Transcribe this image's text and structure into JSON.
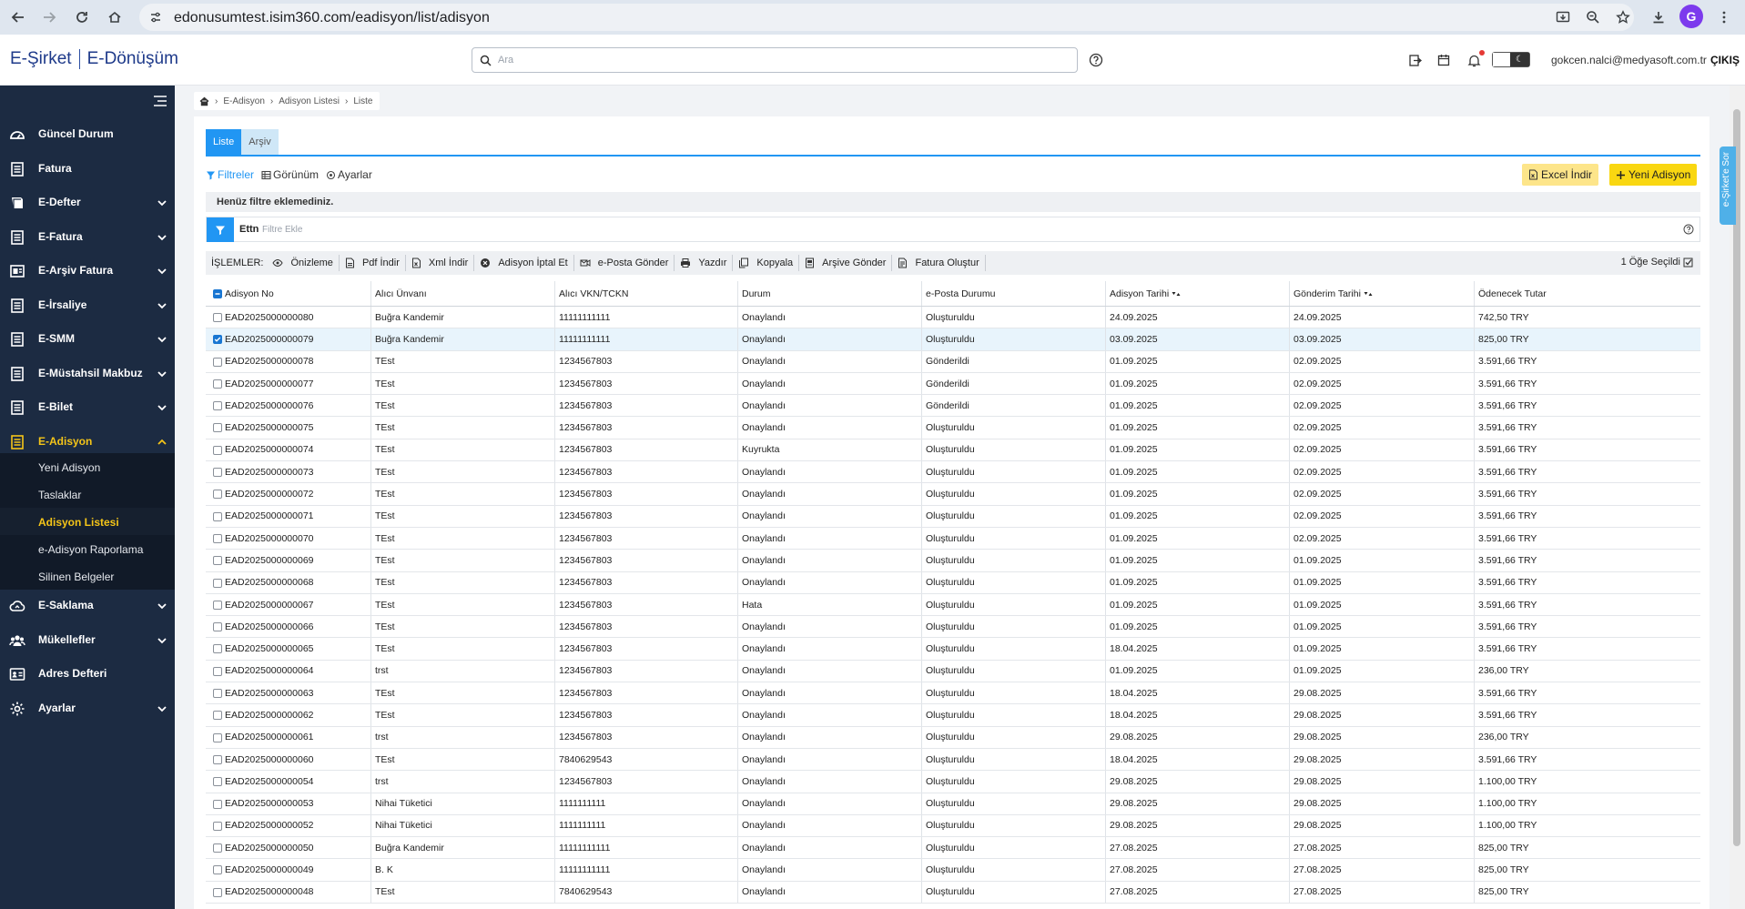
{
  "browser": {
    "url": "edonusumtest.isim360.com/eadisyon/list/adisyon",
    "profile_initial": "G"
  },
  "header": {
    "brand_left": "E-Şirket",
    "brand_right": "E-Dönüşüm",
    "search_placeholder": "Ara",
    "user_email": "gokcen.nalci@medyasoft.com.tr",
    "logout_label": "ÇIKIŞ",
    "notification_dot_color": "#e53935"
  },
  "sidebar": {
    "items": [
      {
        "label": "Güncel Durum",
        "icon": "dashboard-icon",
        "has_chevron": false
      },
      {
        "label": "Fatura",
        "icon": "document-icon",
        "has_chevron": false
      },
      {
        "label": "E-Defter",
        "icon": "book-icon",
        "has_chevron": true
      },
      {
        "label": "E-Fatura",
        "icon": "document-icon",
        "has_chevron": true
      },
      {
        "label": "E-Arşiv Fatura",
        "icon": "archive-document-icon",
        "has_chevron": true
      },
      {
        "label": "E-İrsaliye",
        "icon": "document-icon",
        "has_chevron": true
      },
      {
        "label": "E-SMM",
        "icon": "document-icon",
        "has_chevron": true
      },
      {
        "label": "E-Müstahsil Makbuz",
        "icon": "document-icon",
        "has_chevron": true
      },
      {
        "label": "E-Bilet",
        "icon": "document-icon",
        "has_chevron": true
      },
      {
        "label": "E-Adisyon",
        "icon": "document-icon",
        "has_chevron": true,
        "active": true
      },
      {
        "label": "E-Saklama",
        "icon": "cloud-icon",
        "has_chevron": true
      },
      {
        "label": "Mükellefler",
        "icon": "users-icon",
        "has_chevron": true
      },
      {
        "label": "Adres Defteri",
        "icon": "address-card-icon",
        "has_chevron": false
      },
      {
        "label": "Ayarlar",
        "icon": "gear-icon",
        "has_chevron": true
      }
    ],
    "subitems": [
      {
        "label": "Yeni Adisyon"
      },
      {
        "label": "Taslaklar"
      },
      {
        "label": "Adisyon Listesi",
        "active": true
      },
      {
        "label": "e-Adisyon Raporlama"
      },
      {
        "label": "Silinen Belgeler"
      }
    ],
    "accent_color": "#f5c518"
  },
  "breadcrumb": [
    "E-Adisyon",
    "Adisyon Listesi",
    "Liste"
  ],
  "tabs": [
    {
      "label": "Liste",
      "active": true
    },
    {
      "label": "Arşiv",
      "active": false
    }
  ],
  "toolbar": {
    "filters_label": "Filtreler",
    "view_label": "Görünüm",
    "settings_label": "Ayarlar",
    "excel_label": "Excel İndir",
    "new_label": "Yeni Adisyon"
  },
  "filter": {
    "no_filter_text": "Henüz filtre eklemediniz.",
    "field_label": "Ettn",
    "input_placeholder": "Filtre Ekle"
  },
  "operations": {
    "title": "İŞLEMLER:",
    "items": [
      {
        "label": "Önizleme",
        "icon": "eye-icon"
      },
      {
        "label": "Pdf İndir",
        "icon": "pdf-icon"
      },
      {
        "label": "Xml İndir",
        "icon": "xml-icon"
      },
      {
        "label": "Adisyon İptal Et",
        "icon": "cancel-icon"
      },
      {
        "label": "e-Posta Gönder",
        "icon": "send-mail-icon"
      },
      {
        "label": "Yazdır",
        "icon": "print-icon"
      },
      {
        "label": "Kopyala",
        "icon": "copy-icon"
      },
      {
        "label": "Arşive Gönder",
        "icon": "archive-icon"
      },
      {
        "label": "Fatura Oluştur",
        "icon": "invoice-icon"
      }
    ],
    "selected_text": "1 Öğe Seçildi"
  },
  "table": {
    "columns": [
      "Adisyon No",
      "Alıcı Ünvanı",
      "Alıcı VKN/TCKN",
      "Durum",
      "e-Posta Durumu",
      "Adisyon Tarihi",
      "Gönderim Tarihi",
      "Ödenecek Tutar"
    ],
    "rows": [
      [
        "EAD2025000000080",
        "Buğra Kandemir",
        "11111111111",
        "Onaylandı",
        "Oluşturuldu",
        "24.09.2025",
        "24.09.2025",
        "742,50 TRY"
      ],
      [
        "EAD2025000000079",
        "Buğra Kandemir",
        "11111111111",
        "Onaylandı",
        "Oluşturuldu",
        "03.09.2025",
        "03.09.2025",
        "825,00 TRY"
      ],
      [
        "EAD2025000000078",
        "TEst",
        "1234567803",
        "Onaylandı",
        "Gönderildi",
        "01.09.2025",
        "02.09.2025",
        "3.591,66 TRY"
      ],
      [
        "EAD2025000000077",
        "TEst",
        "1234567803",
        "Onaylandı",
        "Gönderildi",
        "01.09.2025",
        "02.09.2025",
        "3.591,66 TRY"
      ],
      [
        "EAD2025000000076",
        "TEst",
        "1234567803",
        "Onaylandı",
        "Gönderildi",
        "01.09.2025",
        "02.09.2025",
        "3.591,66 TRY"
      ],
      [
        "EAD2025000000075",
        "TEst",
        "1234567803",
        "Onaylandı",
        "Oluşturuldu",
        "01.09.2025",
        "02.09.2025",
        "3.591,66 TRY"
      ],
      [
        "EAD2025000000074",
        "TEst",
        "1234567803",
        "Kuyrukta",
        "Oluşturuldu",
        "01.09.2025",
        "02.09.2025",
        "3.591,66 TRY"
      ],
      [
        "EAD2025000000073",
        "TEst",
        "1234567803",
        "Onaylandı",
        "Oluşturuldu",
        "01.09.2025",
        "02.09.2025",
        "3.591,66 TRY"
      ],
      [
        "EAD2025000000072",
        "TEst",
        "1234567803",
        "Onaylandı",
        "Oluşturuldu",
        "01.09.2025",
        "02.09.2025",
        "3.591,66 TRY"
      ],
      [
        "EAD2025000000071",
        "TEst",
        "1234567803",
        "Onaylandı",
        "Oluşturuldu",
        "01.09.2025",
        "02.09.2025",
        "3.591,66 TRY"
      ],
      [
        "EAD2025000000070",
        "TEst",
        "1234567803",
        "Onaylandı",
        "Oluşturuldu",
        "01.09.2025",
        "02.09.2025",
        "3.591,66 TRY"
      ],
      [
        "EAD2025000000069",
        "TEst",
        "1234567803",
        "Onaylandı",
        "Oluşturuldu",
        "01.09.2025",
        "01.09.2025",
        "3.591,66 TRY"
      ],
      [
        "EAD2025000000068",
        "TEst",
        "1234567803",
        "Onaylandı",
        "Oluşturuldu",
        "01.09.2025",
        "01.09.2025",
        "3.591,66 TRY"
      ],
      [
        "EAD2025000000067",
        "TEst",
        "1234567803",
        "Hata",
        "Oluşturuldu",
        "01.09.2025",
        "01.09.2025",
        "3.591,66 TRY"
      ],
      [
        "EAD2025000000066",
        "TEst",
        "1234567803",
        "Onaylandı",
        "Oluşturuldu",
        "01.09.2025",
        "01.09.2025",
        "3.591,66 TRY"
      ],
      [
        "EAD2025000000065",
        "TEst",
        "1234567803",
        "Onaylandı",
        "Oluşturuldu",
        "18.04.2025",
        "01.09.2025",
        "3.591,66 TRY"
      ],
      [
        "EAD2025000000064",
        "trst",
        "1234567803",
        "Onaylandı",
        "Oluşturuldu",
        "01.09.2025",
        "01.09.2025",
        "236,00 TRY"
      ],
      [
        "EAD2025000000063",
        "TEst",
        "1234567803",
        "Onaylandı",
        "Oluşturuldu",
        "18.04.2025",
        "29.08.2025",
        "3.591,66 TRY"
      ],
      [
        "EAD2025000000062",
        "TEst",
        "1234567803",
        "Onaylandı",
        "Oluşturuldu",
        "18.04.2025",
        "29.08.2025",
        "3.591,66 TRY"
      ],
      [
        "EAD2025000000061",
        "trst",
        "1234567803",
        "Onaylandı",
        "Oluşturuldu",
        "29.08.2025",
        "29.08.2025",
        "236,00 TRY"
      ],
      [
        "EAD2025000000060",
        "TEst",
        "7840629543",
        "Onaylandı",
        "Oluşturuldu",
        "18.04.2025",
        "29.08.2025",
        "3.591,66 TRY"
      ],
      [
        "EAD2025000000054",
        "trst",
        "1234567803",
        "Onaylandı",
        "Oluşturuldu",
        "29.08.2025",
        "29.08.2025",
        "1.100,00 TRY"
      ],
      [
        "EAD2025000000053",
        "Nihai Tüketici",
        "1111111111",
        "Onaylandı",
        "Oluşturuldu",
        "29.08.2025",
        "29.08.2025",
        "1.100,00 TRY"
      ],
      [
        "EAD2025000000052",
        "Nihai Tüketici",
        "1111111111",
        "Onaylandı",
        "Oluşturuldu",
        "29.08.2025",
        "29.08.2025",
        "1.100,00 TRY"
      ],
      [
        "EAD2025000000050",
        "Buğra Kandemir",
        "11111111111",
        "Onaylandı",
        "Oluşturuldu",
        "27.08.2025",
        "27.08.2025",
        "825,00 TRY"
      ],
      [
        "EAD2025000000049",
        "B. K",
        "11111111111",
        "Onaylandı",
        "Oluşturuldu",
        "27.08.2025",
        "27.08.2025",
        "825,00 TRY"
      ],
      [
        "EAD2025000000048",
        "TEst",
        "7840629543",
        "Onaylandı",
        "Oluşturuldu",
        "27.08.2025",
        "27.08.2025",
        "825,00 TRY"
      ]
    ],
    "selected_row": 1
  },
  "rail": {
    "label": "e-Şirket'e Sor"
  },
  "colors": {
    "primary": "#2196f3",
    "sidebar_bg": "#1c2b42",
    "button_yellow": "#f9d711"
  }
}
